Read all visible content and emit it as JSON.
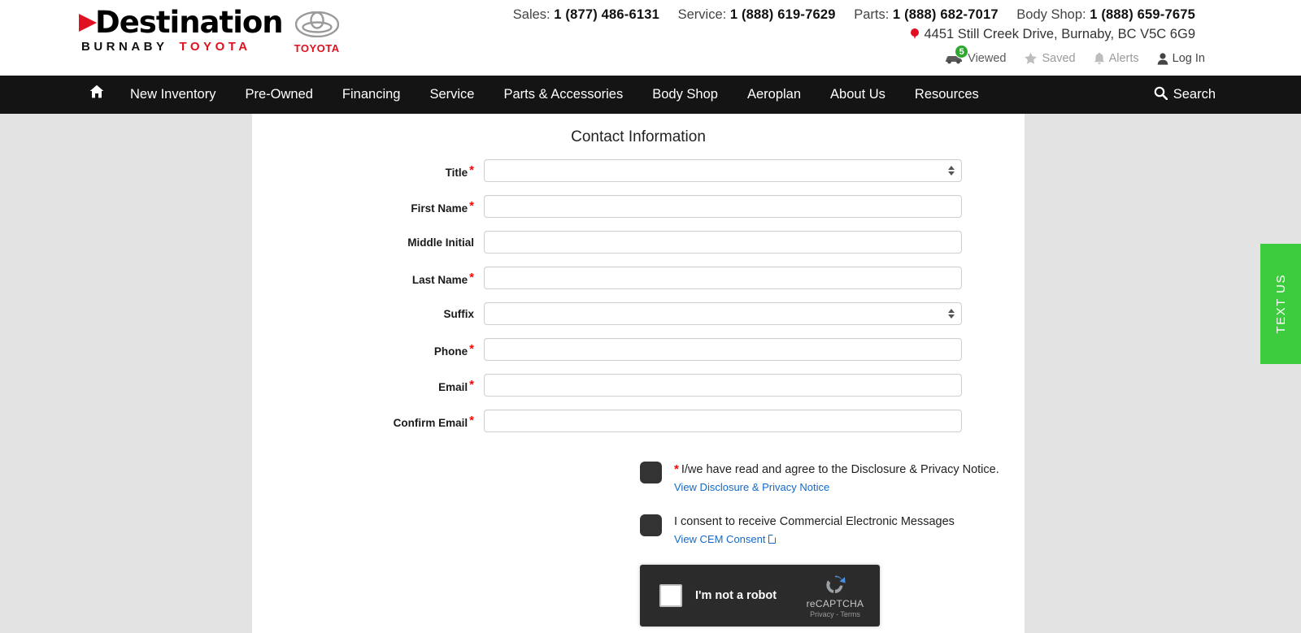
{
  "header": {
    "logo": {
      "word": "Destination",
      "sub_left": "BURNABY",
      "sub_right": "TOYOTA",
      "badge_word": "TOYOTA"
    },
    "contacts": [
      {
        "label": "Sales:",
        "number": "1 (877) 486-6131"
      },
      {
        "label": "Service:",
        "number": "1 (888) 619-7629"
      },
      {
        "label": "Parts:",
        "number": "1 (888) 682-7017"
      },
      {
        "label": "Body Shop:",
        "number": "1 (888) 659-7675"
      }
    ],
    "address": "4451 Still Creek Drive, Burnaby, BC V5C 6G9",
    "account": [
      {
        "icon": "car-icon",
        "label": "Viewed",
        "badge": "5"
      },
      {
        "icon": "star-icon",
        "label": "Saved",
        "badge": ""
      },
      {
        "icon": "bell-icon",
        "label": "Alerts",
        "badge": ""
      },
      {
        "icon": "user-icon",
        "label": "Log In",
        "badge": ""
      }
    ]
  },
  "nav": {
    "home_icon": "home-icon",
    "items": [
      "New Inventory",
      "Pre-Owned",
      "Financing",
      "Service",
      "Parts & Accessories",
      "Body Shop",
      "Aeroplan",
      "About Us",
      "Resources"
    ],
    "search_label": "Search",
    "search_icon": "search-icon"
  },
  "form": {
    "title": "Contact Information",
    "fields": [
      {
        "label": "Title",
        "required": true,
        "type": "select",
        "value": ""
      },
      {
        "label": "First Name",
        "required": true,
        "type": "text",
        "value": ""
      },
      {
        "label": "Middle Initial",
        "required": false,
        "type": "text",
        "value": ""
      },
      {
        "label": "Last Name",
        "required": true,
        "type": "text",
        "value": ""
      },
      {
        "label": "Suffix",
        "required": false,
        "type": "select",
        "value": ""
      },
      {
        "label": "Phone",
        "required": true,
        "type": "text",
        "value": ""
      },
      {
        "label": "Email",
        "required": true,
        "type": "text",
        "value": ""
      },
      {
        "label": "Confirm Email",
        "required": true,
        "type": "text",
        "value": ""
      }
    ],
    "consents": [
      {
        "required": true,
        "text": "I/we have read and agree to the Disclosure & Privacy Notice.",
        "link": "View Disclosure & Privacy Notice",
        "has_pdf_icon": false,
        "checked": false
      },
      {
        "required": false,
        "text": "I consent to receive Commercial Electronic Messages",
        "link": "View CEM Consent",
        "has_pdf_icon": true,
        "checked": false
      }
    ],
    "recaptcha": {
      "label": "I'm not a robot",
      "brand": "reCAPTCHA",
      "terms": "Privacy - Terms",
      "checked": false
    }
  },
  "widgets": {
    "text_us": "TEXT US"
  },
  "colors": {
    "brand_red": "#e01020",
    "nav_dark": "#141414",
    "link_blue": "#1569c7",
    "text_us_green": "#3dcc3d",
    "badge_green": "#2ea82e",
    "required_red": "#ff0000"
  }
}
